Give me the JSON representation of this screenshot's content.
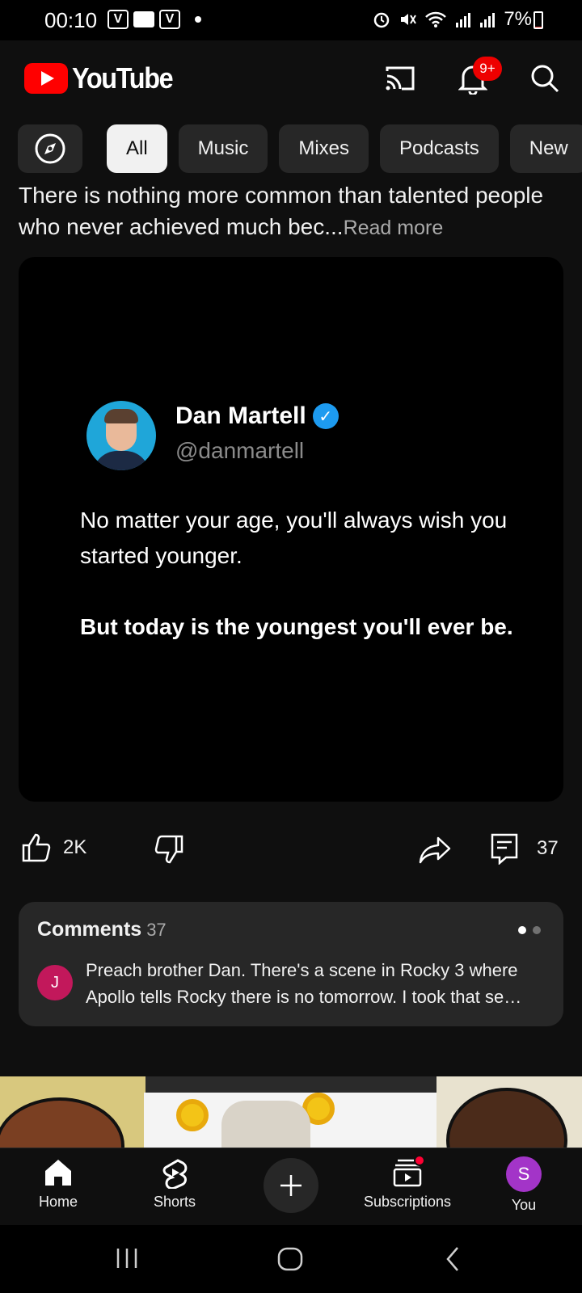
{
  "status_bar": {
    "time": "00:10",
    "battery": "7%",
    "battery_level": 0.07
  },
  "header": {
    "logo_text": "YouTube",
    "notification_badge": "9+"
  },
  "chips": [
    {
      "label": "All",
      "active": true
    },
    {
      "label": "Music"
    },
    {
      "label": "Mixes"
    },
    {
      "label": "Podcasts"
    },
    {
      "label": "New"
    }
  ],
  "post": {
    "text": "There is nothing more common than talented people who never achieved much bec",
    "ellipsis": "...",
    "read_more": "Read more",
    "image": {
      "author_name": "Dan Martell",
      "author_handle": "@danmartell",
      "line1": "No matter your age, you'll always wish you started younger.",
      "line2": "But today is the youngest you'll ever be."
    }
  },
  "actions": {
    "likes": "2K",
    "comments": "37"
  },
  "comments": {
    "title": "Comments",
    "count": "37",
    "first_avatar_letter": "J",
    "first_comment": "Preach brother Dan. There's a scene in Rocky 3 where Apollo tells Rocky there is no tomorrow. I took that se…"
  },
  "bottom_nav": {
    "home": "Home",
    "shorts": "Shorts",
    "subscriptions": "Subscriptions",
    "you": "You",
    "you_avatar_letter": "S"
  },
  "colors": {
    "background": "#0f0f0f",
    "brand_red": "#ff0000",
    "chip_bg": "#272727",
    "verified_blue": "#1d9bf0",
    "comment_avatar": "#c2185b",
    "you_avatar": "#a334c8"
  },
  "icons": {
    "cast": "cast-icon",
    "notifications": "bell-icon",
    "search": "search-icon",
    "explore": "compass-icon",
    "like": "thumbs-up-icon",
    "dislike": "thumbs-down-icon",
    "share": "share-icon",
    "comment": "comment-icon",
    "home": "home-icon",
    "shorts": "shorts-icon",
    "create": "plus-icon",
    "subscriptions": "subscriptions-icon"
  }
}
